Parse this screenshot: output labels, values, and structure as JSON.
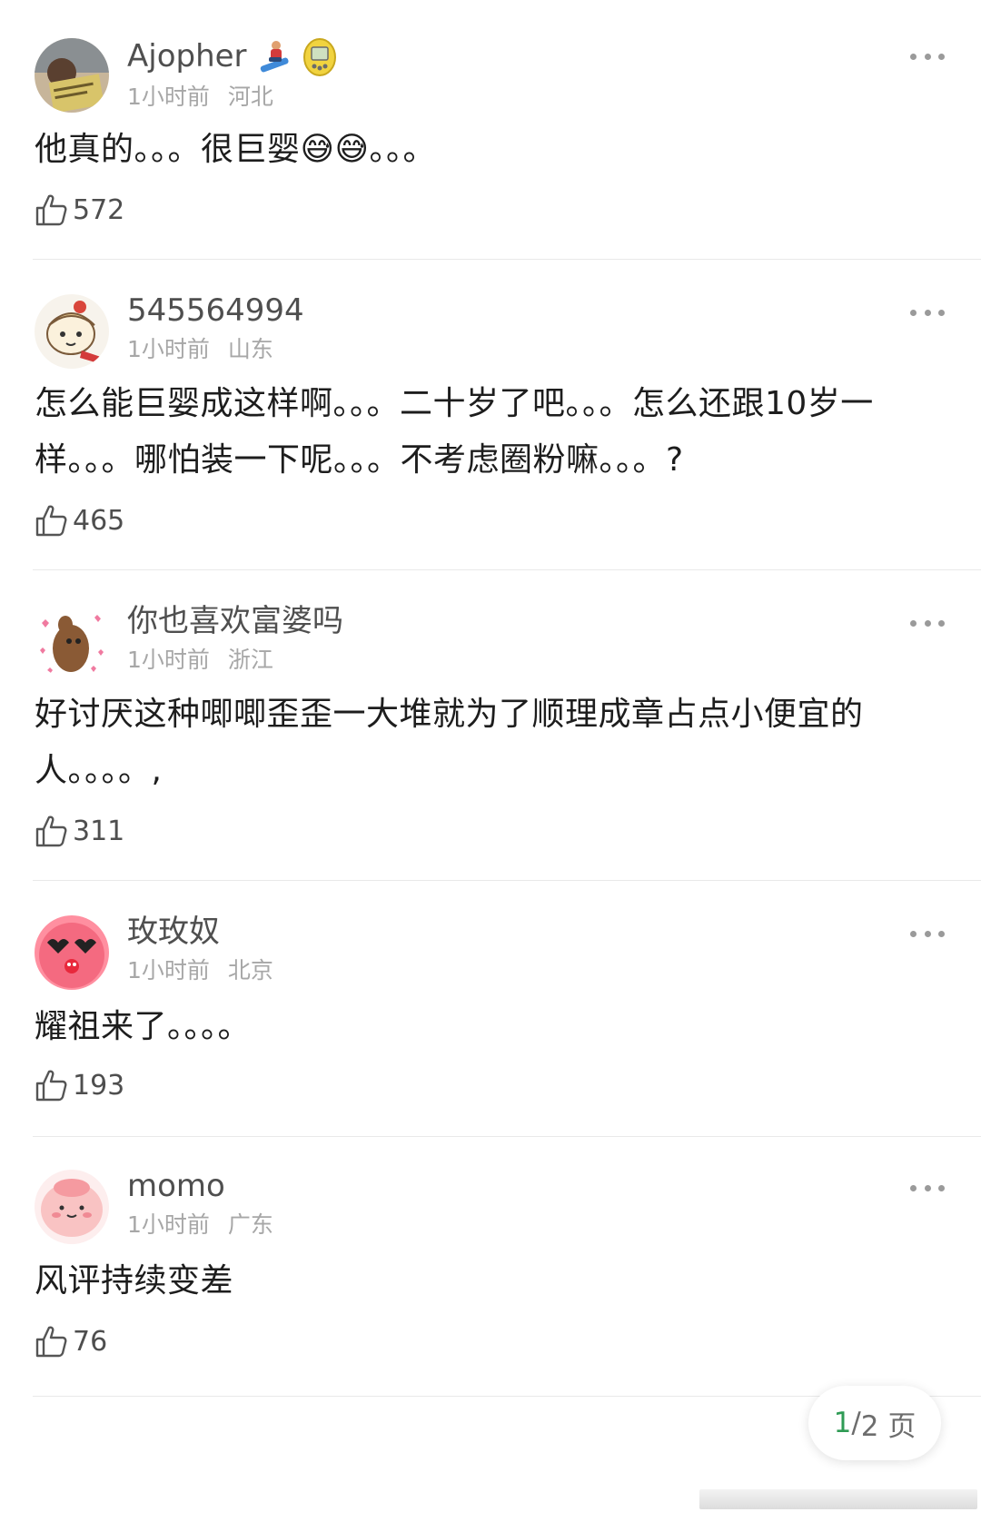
{
  "comments": [
    {
      "username": "Ajopher",
      "time": "1小时前",
      "location": "河北",
      "content": "他真的。。。很巨婴😅😅。。。",
      "likes": "572"
    },
    {
      "username": "545564994",
      "time": "1小时前",
      "location": "山东",
      "content": "怎么能巨婴成这样啊。。。二十岁了吧。。。怎么还跟10岁一样。。。哪怕装一下呢。。。不考虑圈粉嘛。。。?",
      "likes": "465"
    },
    {
      "username": "你也喜欢富婆吗",
      "time": "1小时前",
      "location": "浙江",
      "content": "好讨厌这种唧唧歪歪一大堆就为了顺理成章占点小便宜的人。。。。,",
      "likes": "311"
    },
    {
      "username": "玫玫奴",
      "time": "1小时前",
      "location": "北京",
      "content": "耀祖来了。。。。",
      "likes": "193"
    },
    {
      "username": "momo",
      "time": "1小时前",
      "location": "广东",
      "content": "风评持续变差",
      "likes": "76"
    }
  ],
  "pagination": {
    "current": "1",
    "separator": "/",
    "total_label": "2 页"
  },
  "colors": {
    "accent_green": "#2f9b55",
    "meta_gray": "#a7a7a7"
  }
}
